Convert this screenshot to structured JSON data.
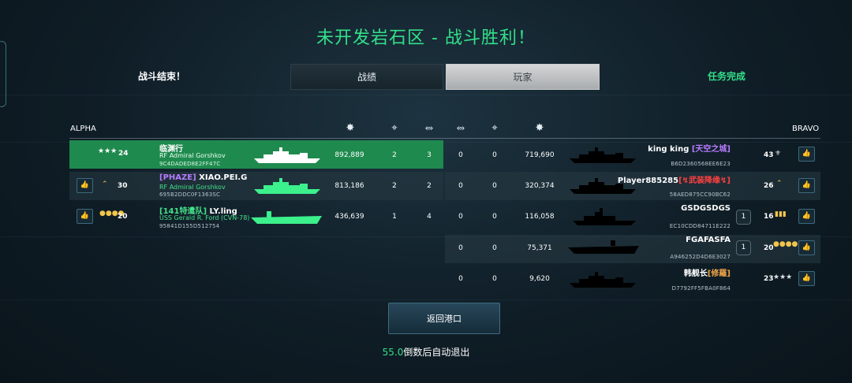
{
  "title": "未开发岩石区 - 战斗胜利！",
  "tabs": {
    "battle_end": "战斗结束！",
    "stats": "战绩",
    "players": "玩家",
    "mission": "任务完成"
  },
  "teams": {
    "left": "ALPHA",
    "right": "BRAVO"
  },
  "header_icons": [
    "damage-icon",
    "kills-icon",
    "assist-icon",
    "assist-icon",
    "kills-icon",
    "damage-icon"
  ],
  "left_players": [
    {
      "rank_icon": "star-rank-icon",
      "level": "24",
      "name": "临渊行",
      "ship": "RF Admiral Gorshkov",
      "id": "9C4DADED8E2FF47C",
      "damage": "892,889",
      "kills": "2",
      "assists": "3",
      "selected": true,
      "ship_color": "#ffffff"
    },
    {
      "rank_icon": "chevron-rank-icon",
      "level": "30",
      "tag": "[PHAZE]",
      "name": "XIAO.PEI.G",
      "ship": "RF Admiral Gorshkov",
      "id": "695B2DDC0F1363SC",
      "damage": "813,186",
      "kills": "2",
      "assists": "2",
      "selected": false,
      "ship_color": "#3cf08c"
    },
    {
      "rank_icon": "medal-rank-icon",
      "level": "20",
      "tag": "[141特遣队]",
      "name": "LY.ling",
      "ship": "USS Gerald R. Ford (CVN-78)",
      "id": "95841D155D512754",
      "damage": "436,639",
      "kills": "1",
      "assists": "4",
      "selected": false,
      "ship_color": "#3cf08c"
    }
  ],
  "right_players": [
    {
      "assists": "0",
      "kills": "0",
      "damage": "719,690",
      "name": "king king",
      "tag": "[天空之城]",
      "tag_class": "tag-purple",
      "id": "B6D2360568EE6E23",
      "level": "43",
      "rank_icon": "wings-rank-icon",
      "extra_badge": ""
    },
    {
      "assists": "0",
      "kills": "0",
      "damage": "320,374",
      "name": "Player885285",
      "tag": "[↯武装降缘↯]",
      "tag_class": "tag-red",
      "id": "58AED875CC90BC62",
      "level": "26",
      "rank_icon": "chevron-rank-icon",
      "extra_badge": ""
    },
    {
      "assists": "0",
      "kills": "0",
      "damage": "116,058",
      "name": "GSDGSDGS",
      "tag": "",
      "tag_class": "",
      "id": "EC10CDD84711E222",
      "level": "16",
      "rank_icon": "medal-rank-icon",
      "extra_badge": "1"
    },
    {
      "assists": "0",
      "kills": "0",
      "damage": "75,371",
      "name": "FGAFASFA",
      "tag": "",
      "tag_class": "",
      "id": "A946252D4D6E3027",
      "level": "20",
      "rank_icon": "medal-rank-icon",
      "extra_badge": "1"
    },
    {
      "assists": "0",
      "kills": "0",
      "damage": "9,620",
      "name": "韩舰长",
      "tag": "[修羅]",
      "tag_class": "tag-orange",
      "id": "D7792FF5FBA0F864",
      "level": "23",
      "rank_icon": "star-rank-icon",
      "extra_badge": ""
    }
  ],
  "return_button": "返回港口",
  "countdown": {
    "seconds": "55.0",
    "text": "倒数后自动退出"
  },
  "colors": {
    "accent_green": "#33e08a",
    "selected_row": "#1f8a4e",
    "enemy_ship": "#000000"
  }
}
